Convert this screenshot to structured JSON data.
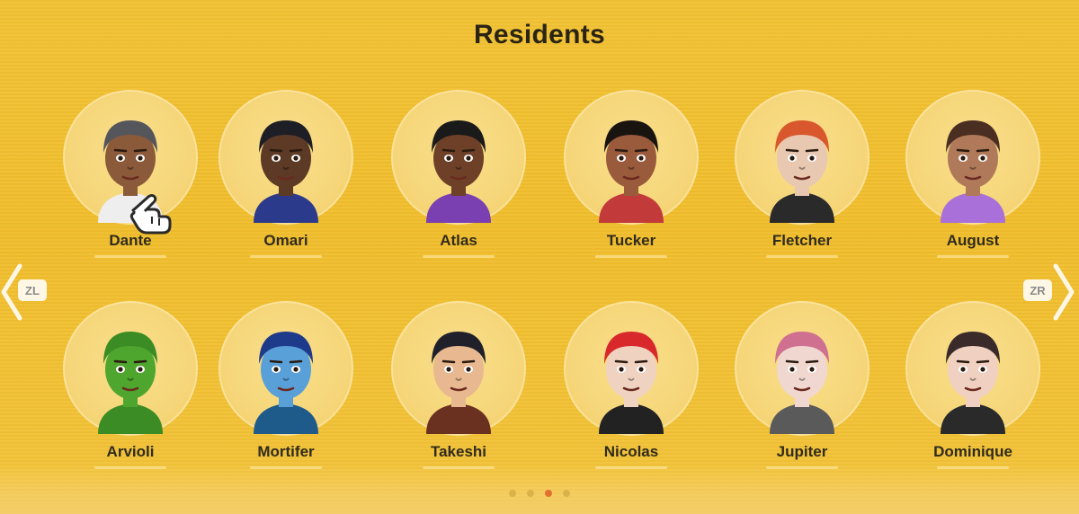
{
  "screen": {
    "title": "Residents"
  },
  "colors": {
    "background": "#f0bd2c",
    "bubble": "#f6d67a",
    "text": "#2f2a1c",
    "active_dot": "#e2702f"
  },
  "nav": {
    "left_label": "ZL",
    "right_label": "ZR"
  },
  "pagination": {
    "pages": 4,
    "current_page": 3
  },
  "residents": [
    {
      "name": "Dante",
      "skin": "#8a5a3a",
      "hair": "#55565c",
      "shirt": "#eeeeee",
      "row": 0
    },
    {
      "name": "Omari",
      "skin": "#5c3a26",
      "hair": "#1e1e26",
      "shirt": "#2c3a8c",
      "row": 0
    },
    {
      "name": "Atlas",
      "skin": "#6e4028",
      "hair": "#1a1a1a",
      "shirt": "#7a3fb0",
      "row": 0
    },
    {
      "name": "Tucker",
      "skin": "#9a5a3c",
      "hair": "#1a1410",
      "shirt": "#c23a3a",
      "row": 0
    },
    {
      "name": "Fletcher",
      "skin": "#e8c8b0",
      "hair": "#d8572c",
      "shirt": "#2a2a2a",
      "row": 0
    },
    {
      "name": "August",
      "skin": "#b07a5a",
      "hair": "#4a2e22",
      "shirt": "#a870d8",
      "row": 0
    },
    {
      "name": "Arvioli",
      "skin": "#4ea62e",
      "hair": "#3b8c24",
      "shirt": "#3b8c24",
      "row": 1
    },
    {
      "name": "Mortifer",
      "skin": "#5aa0d8",
      "hair": "#1e3a8a",
      "shirt": "#1e5a8a",
      "row": 1
    },
    {
      "name": "Takeshi",
      "skin": "#e8b890",
      "hair": "#20202a",
      "shirt": "#6a3020",
      "row": 1
    },
    {
      "name": "Nicolas",
      "skin": "#f0d2c0",
      "hair": "#d8282c",
      "shirt": "#222222",
      "row": 1
    },
    {
      "name": "Jupiter",
      "skin": "#f0d8d0",
      "hair": "#d07090",
      "shirt": "#5a5a5a",
      "row": 1
    },
    {
      "name": "Dominique",
      "skin": "#f0d0c0",
      "hair": "#3a2a2a",
      "shirt": "#2a2a2a",
      "row": 1
    }
  ]
}
